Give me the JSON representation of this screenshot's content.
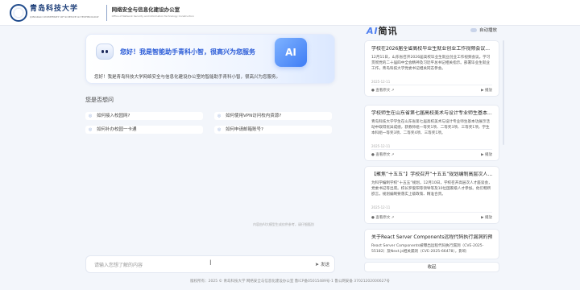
{
  "header": {
    "university_name": "青岛科技大学",
    "university_name_en": "QINGDAO UNIVERSITY OF SCIENCE & TECHNOLOGY",
    "office_name": "网络安全与信息化建设办公室",
    "office_name_en": "Office of Network Security and Information Technology Construction"
  },
  "welcome": {
    "greeting": "您好！我是智能助手青科小智，很高兴为您服务",
    "ai_badge": "AI",
    "intro": "您好！我是青岛科技大学网络安全与信息化建设办公室的智能助手青科小智，很高兴为您服务。"
  },
  "faq": {
    "title": "您是否想问",
    "items": [
      "如何接入校园网?",
      "如何使用VPN访问校内资源?",
      "如何补办校园一卡通",
      "如何申请邮箱账号?"
    ]
  },
  "notice": "内容由AI大模型生成仅供参考，请仔细甄别",
  "input": {
    "placeholder": "请输入您想了解的内容",
    "send_label": "发送"
  },
  "footer": "版权所有：2025 © 青岛科技大学 网络安全与信息化建设办公室 鲁ICP备05015489号-1 鲁公网安备 37021202000627号",
  "news": {
    "title_ai": "AI",
    "title_rest": "简讯",
    "autoplay_label": "自动播放",
    "cards": [
      {
        "title": "学校在2026届全省高校毕业生就业创业工作视频会议...",
        "summary": "12月11日，山东省召开2026届高校毕业生就业创业工作视频会议。学习贯彻党的二十届四中全会精神及习近平总书记相关指示。部署毕业生就业工作，青岛科技大学党委书记相关同志参会。",
        "date": "2025-12-11",
        "source": "● 查看原文 ↗",
        "action": "播放"
      },
      {
        "title": "学校师生在山东省第七届高校美术与设计专业师生基本...",
        "summary": "青岛科技大学学生在山东省第七届高校美术与设计专业师生基本功展示活动中取得优异成绩，获教师组一等奖1项、二等奖3项、三等奖1项，学生本科组一等奖3项、二等奖4项、三等奖1项。",
        "date": "2025-12-11",
        "source": "● 查看原文 ↗",
        "action": "播放"
      },
      {
        "title": "【聚焦“十五五”】学校召开“十五五”规划编制高层次人...",
        "summary": "为科学编制学校“十五五”规划，12月10日，学校召开高层次人才座谈会，党委书记等出席。校长罗俊阳等领导等及10位国家级人才参加。他们畅所欲言，规划编制要落实上级政策、精准合贵。",
        "date": "2025-12-11",
        "source": "● 查看原文 ↗",
        "action": "播放"
      },
      {
        "title": "关于React Server Components远程代码执行漏洞的预...",
        "summary": "React Server Components被曝出远程代码执行漏洞（CVE-2025-55182）及Next.js相关漏洞（CVE-2025-66478），影响",
        "date": "",
        "source": "",
        "action": ""
      }
    ],
    "collapse_label": "收起"
  }
}
